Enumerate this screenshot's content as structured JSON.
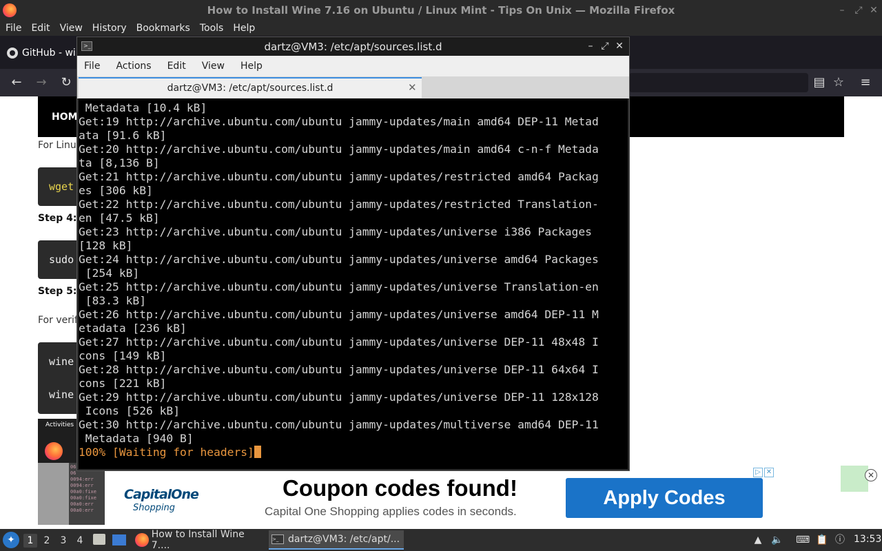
{
  "firefox": {
    "window_title": "How to Install Wine 7.16 on Ubuntu / Linux Mint - Tips On Unix — Mozilla Firefox",
    "menu": [
      "File",
      "Edit",
      "View",
      "History",
      "Bookmarks",
      "Tools",
      "Help"
    ],
    "tab_github": "GitHub - wir",
    "win_controls": {
      "minimize": "–",
      "maximize": "⤢",
      "close": "✕"
    },
    "nav": {
      "back": "←",
      "forward": "→",
      "reload": "↻",
      "reader": "▤",
      "bookmark": "☆",
      "menu": "≡"
    }
  },
  "webpage": {
    "nav_home": "HOM",
    "text_for_linux": "For Linu",
    "code1": "wget",
    "step4": "Step 4:",
    "code2": "sudo",
    "step5": "Step 5:",
    "text_verify": "For verif",
    "code3a": "wine",
    "code3b": "wine",
    "activities": "Activities"
  },
  "ad": {
    "brand_line1": "CapitalOne",
    "brand_line2": "Shopping",
    "headline": "Coupon codes found!",
    "subline": "Capital One Shopping applies codes in seconds.",
    "button": "Apply Codes",
    "adchoices": "▷",
    "adx": "✕",
    "close": "✕",
    "thumb_term": "06\n06\n0094:err\n0094:err\n00a0:fixe\n00a0:fixe\n00a0:err\n00a0:err"
  },
  "terminal": {
    "title": "dartz@VM3: /etc/apt/sources.list.d",
    "menu": [
      "File",
      "Actions",
      "Edit",
      "View",
      "Help"
    ],
    "tab_label": "dartz@VM3: /etc/apt/sources.list.d",
    "tab_close": "✕",
    "controls": {
      "minimize": "–",
      "maximize": "⤢",
      "close": "✕"
    },
    "output": [
      " Metadata [10.4 kB]",
      "Get:19 http://archive.ubuntu.com/ubuntu jammy-updates/main amd64 DEP-11 Metad",
      "ata [91.6 kB]",
      "Get:20 http://archive.ubuntu.com/ubuntu jammy-updates/main amd64 c-n-f Metada",
      "ta [8,136 B]",
      "Get:21 http://archive.ubuntu.com/ubuntu jammy-updates/restricted amd64 Packag",
      "es [306 kB]",
      "Get:22 http://archive.ubuntu.com/ubuntu jammy-updates/restricted Translation-",
      "en [47.5 kB]",
      "Get:23 http://archive.ubuntu.com/ubuntu jammy-updates/universe i386 Packages",
      "[128 kB]",
      "Get:24 http://archive.ubuntu.com/ubuntu jammy-updates/universe amd64 Packages",
      " [254 kB]",
      "Get:25 http://archive.ubuntu.com/ubuntu jammy-updates/universe Translation-en",
      " [83.3 kB]",
      "Get:26 http://archive.ubuntu.com/ubuntu jammy-updates/universe amd64 DEP-11 M",
      "etadata [236 kB]",
      "Get:27 http://archive.ubuntu.com/ubuntu jammy-updates/universe DEP-11 48x48 I",
      "cons [149 kB]",
      "Get:28 http://archive.ubuntu.com/ubuntu jammy-updates/universe DEP-11 64x64 I",
      "cons [221 kB]",
      "Get:29 http://archive.ubuntu.com/ubuntu jammy-updates/universe DEP-11 128x128",
      " Icons [526 kB]",
      "Get:30 http://archive.ubuntu.com/ubuntu jammy-updates/multiverse amd64 DEP-11",
      " Metadata [940 B]"
    ],
    "progress_line": "100% [Waiting for headers]"
  },
  "taskbar": {
    "workspaces": [
      "1",
      "2",
      "3",
      "4"
    ],
    "task_firefox": "How to Install Wine 7....",
    "task_terminal": "dartz@VM3: /etc/apt/...",
    "clock": "13:53"
  },
  "colors": {
    "terminal_progress": "#e9963e",
    "ad_button": "#1a73c8",
    "tab_accent": "#3d8ee0"
  }
}
